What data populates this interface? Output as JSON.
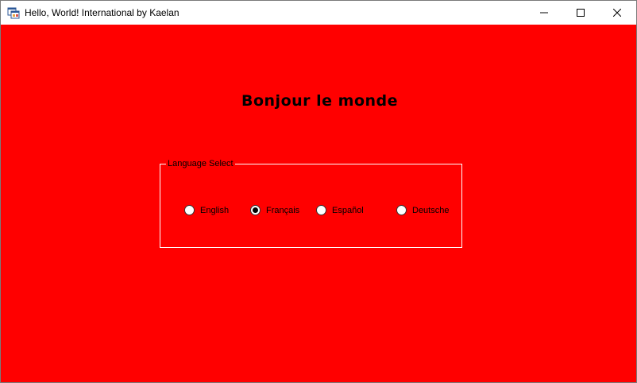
{
  "window": {
    "title": "Hello, World! International by Kaelan",
    "controls": {
      "minimize_icon": "minimize-icon",
      "maximize_icon": "maximize-icon",
      "close_icon": "close-icon"
    }
  },
  "main": {
    "greeting": "Bonjour le monde",
    "background_color": "#ff0000"
  },
  "language_group": {
    "legend": "Language Select",
    "options": [
      {
        "label": "English",
        "selected": false
      },
      {
        "label": "Français",
        "selected": true
      },
      {
        "label": "Español",
        "selected": false
      },
      {
        "label": "Deutsche",
        "selected": false
      }
    ]
  }
}
